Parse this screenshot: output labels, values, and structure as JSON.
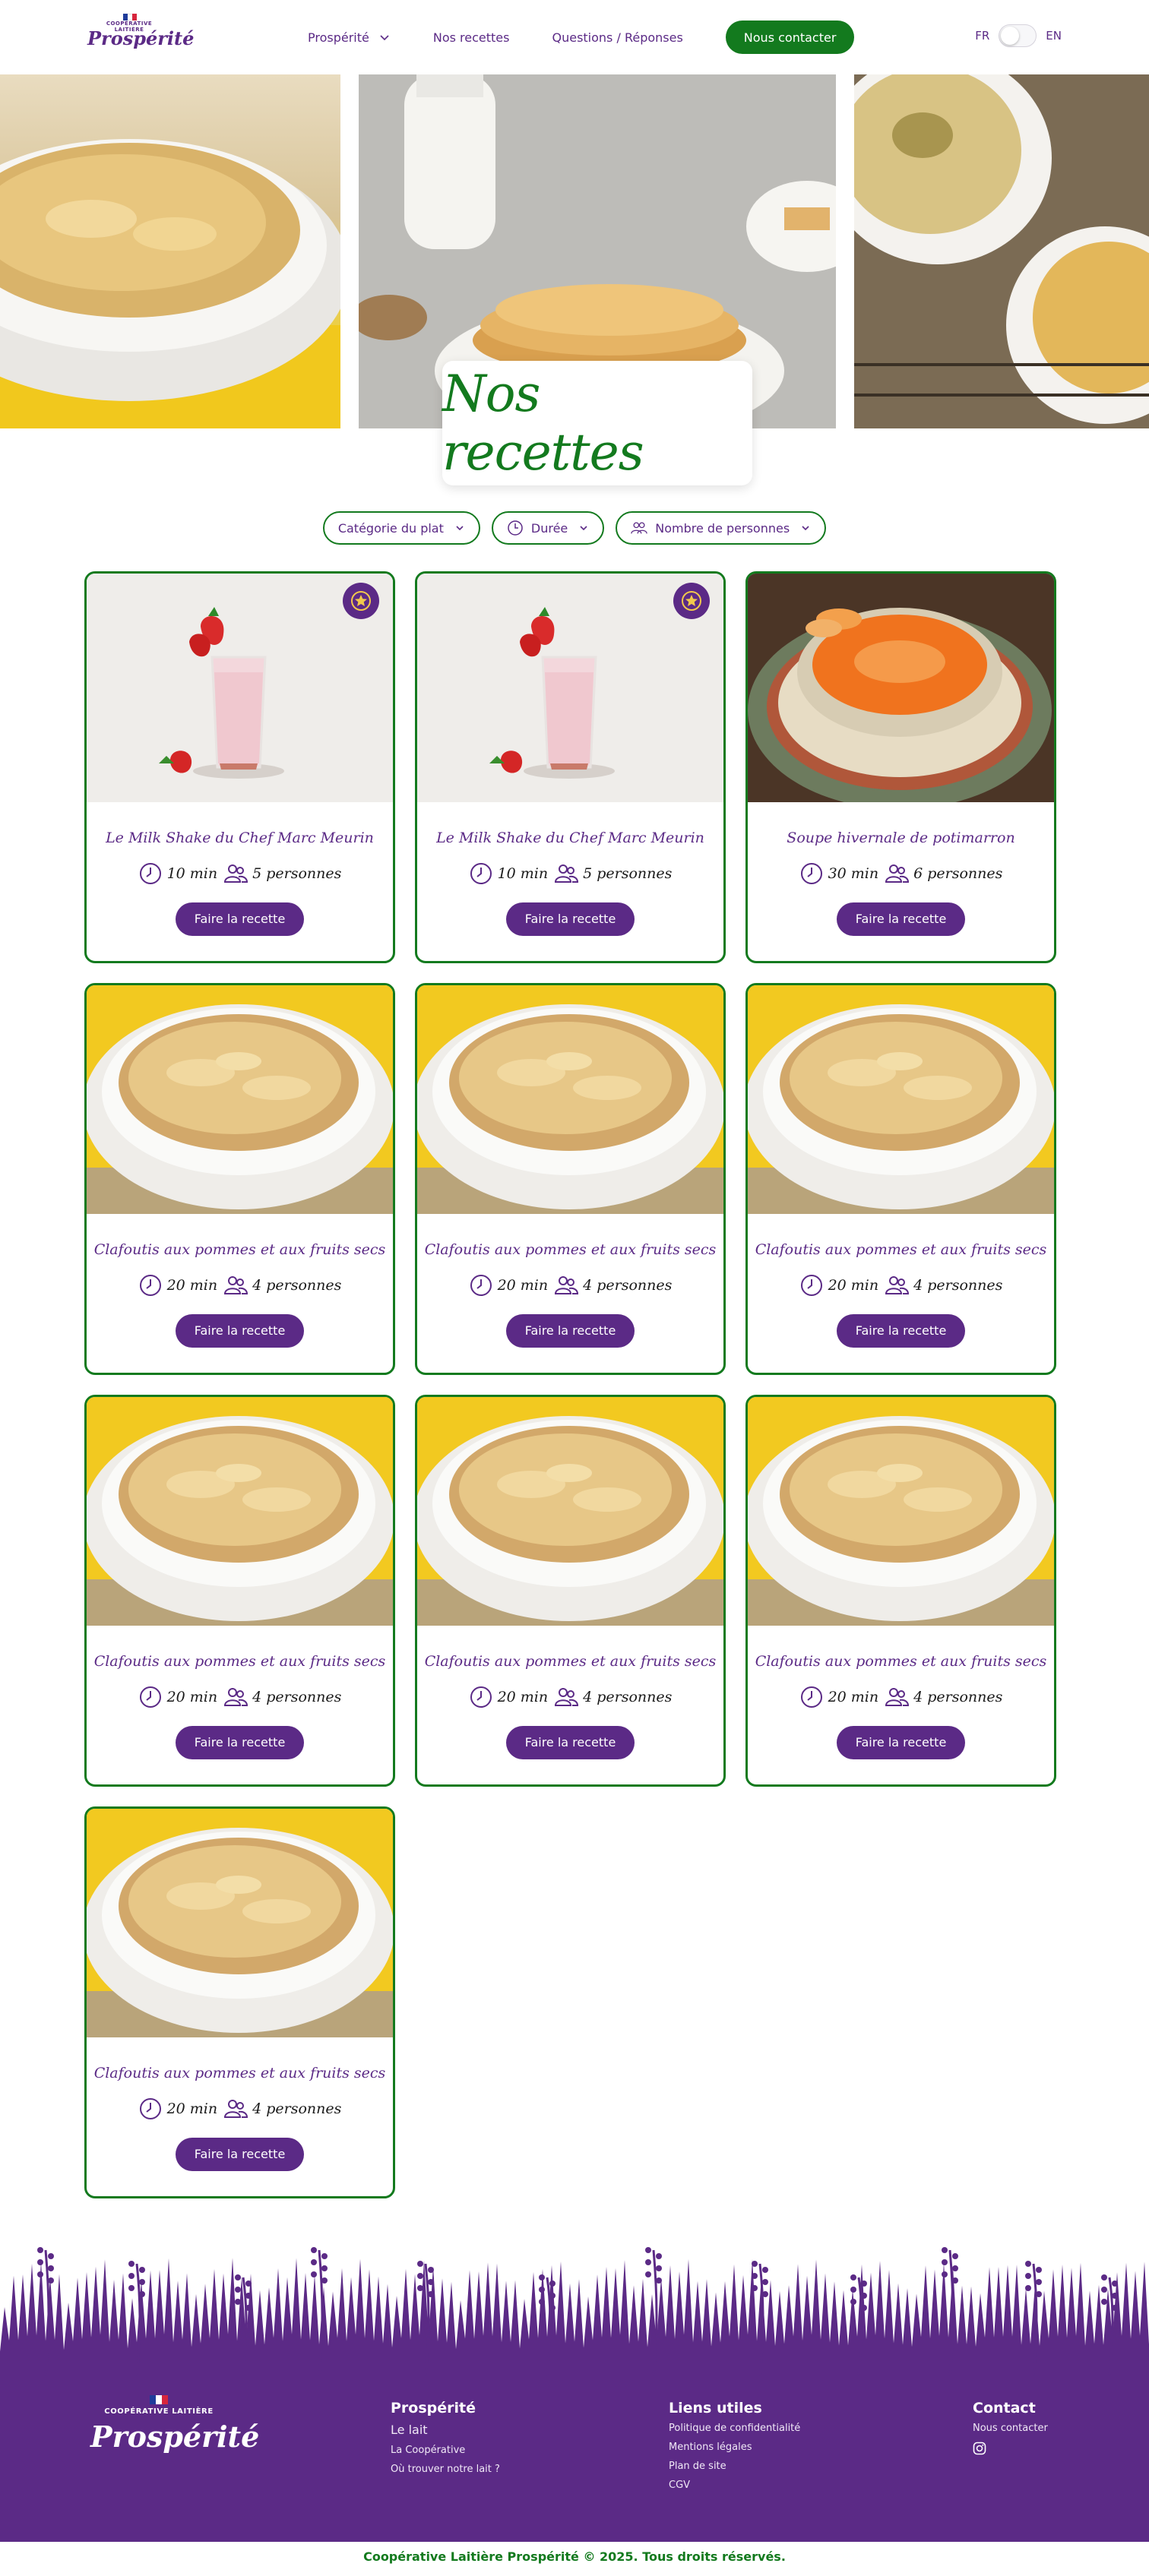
{
  "header": {
    "logo_top": "COOPÉRATIVE LAITIÈRE",
    "logo_brand": "Prospérité",
    "nav": [
      {
        "label": "Prospérité",
        "has_dropdown": true
      },
      {
        "label": "Nos recettes",
        "has_dropdown": false
      },
      {
        "label": "Questions / Réponses",
        "has_dropdown": false
      }
    ],
    "contact_label": "Nous contacter",
    "lang_fr": "FR",
    "lang_en": "EN"
  },
  "hero": {
    "title": "Nos recettes"
  },
  "filters": [
    {
      "label": "Catégorie du plat",
      "icon": "none"
    },
    {
      "label": "Durée",
      "icon": "clock-icon"
    },
    {
      "label": "Nombre de personnes",
      "icon": "people-icon"
    }
  ],
  "cards": [
    {
      "title": "Le Milk Shake du Chef Marc Meurin",
      "time": "10 min",
      "people": "5 personnes",
      "image": "milkshake",
      "featured": true,
      "button": "Faire la recette"
    },
    {
      "title": "Le Milk Shake du Chef Marc Meurin",
      "time": "10 min",
      "people": "5 personnes",
      "image": "milkshake",
      "featured": true,
      "button": "Faire la recette"
    },
    {
      "title": "Soupe hivernale de potimarron",
      "time": "30 min",
      "people": "6 personnes",
      "image": "soup",
      "featured": false,
      "button": "Faire la recette"
    },
    {
      "title": "Clafoutis aux pommes et aux fruits secs",
      "time": "20 min",
      "people": "4 personnes",
      "image": "clafoutis",
      "featured": false,
      "button": "Faire la recette"
    },
    {
      "title": "Clafoutis aux pommes et aux fruits secs",
      "time": "20 min",
      "people": "4 personnes",
      "image": "clafoutis",
      "featured": false,
      "button": "Faire la recette"
    },
    {
      "title": "Clafoutis aux pommes et aux fruits secs",
      "time": "20 min",
      "people": "4 personnes",
      "image": "clafoutis",
      "featured": false,
      "button": "Faire la recette"
    },
    {
      "title": "Clafoutis aux pommes et aux fruits secs",
      "time": "20 min",
      "people": "4 personnes",
      "image": "clafoutis",
      "featured": false,
      "button": "Faire la recette"
    },
    {
      "title": "Clafoutis aux pommes et aux fruits secs",
      "time": "20 min",
      "people": "4 personnes",
      "image": "clafoutis",
      "featured": false,
      "button": "Faire la recette"
    },
    {
      "title": "Clafoutis aux pommes et aux fruits secs",
      "time": "20 min",
      "people": "4 personnes",
      "image": "clafoutis",
      "featured": false,
      "button": "Faire la recette"
    },
    {
      "title": "Clafoutis aux pommes et aux fruits secs",
      "time": "20 min",
      "people": "4 personnes",
      "image": "clafoutis",
      "featured": false,
      "button": "Faire la recette"
    }
  ],
  "footer": {
    "logo_top": "COOPÉRATIVE LAITIÈRE",
    "logo_brand": "Prospérité",
    "col1": {
      "title": "Prospérité",
      "links": [
        "Le lait",
        "La Coopérative",
        "Où trouver notre lait ?"
      ]
    },
    "col2": {
      "title": "Liens utiles",
      "links": [
        "Politique de confidentialité",
        "Mentions légales",
        "Plan de site",
        "CGV"
      ]
    },
    "col3": {
      "title": "Contact",
      "links": [
        "Nous contacter"
      ]
    },
    "copyright": "Coopérative Laitière Prospérité © 2025. Tous droits réservés."
  },
  "colors": {
    "green": "#137a1e",
    "purple": "#5b2a86",
    "gold": "#f2c94c"
  }
}
